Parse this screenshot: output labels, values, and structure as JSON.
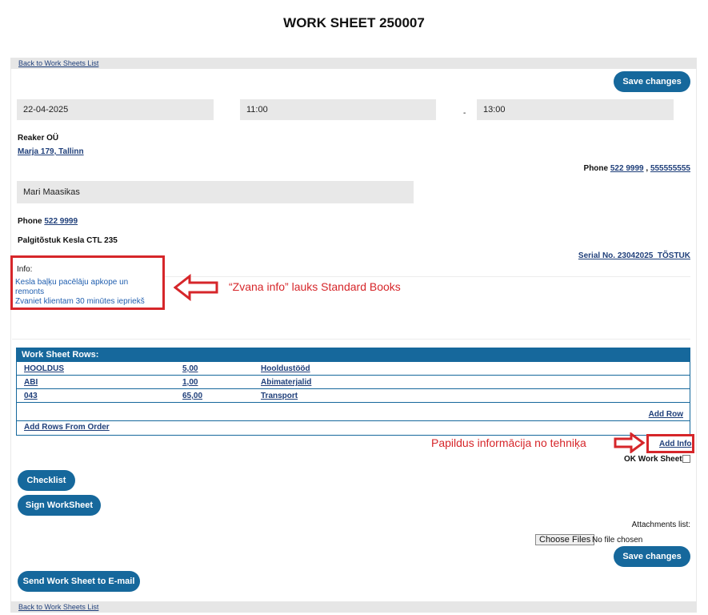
{
  "page": {
    "title": "WORK SHEET 250007"
  },
  "nav": {
    "back_link": "Back to Work Sheets List"
  },
  "actions": {
    "save_label": "Save changes",
    "checklist_label": "Checklist",
    "sign_label": "Sign WorkSheet",
    "send_email_label": "Send Work Sheet to E-mail"
  },
  "schedule": {
    "date": "22-04-2025",
    "time_from": "11:00",
    "separator": "-",
    "time_to": "13:00"
  },
  "client": {
    "name": "Reaker OÜ",
    "address": "Marja 179, Tallinn",
    "phone_label": "Phone",
    "phone1": "522 9999",
    "phone_sep": ",",
    "phone2": "555555555"
  },
  "contact": {
    "name": "Mari Maasikas",
    "phone_label": "Phone",
    "phone": "522 9999"
  },
  "device": {
    "name": "Palgitõstuk Kesla CTL 235",
    "serial": "Serial No. 23042025_TÕSTUK"
  },
  "info": {
    "label": "Info:",
    "line1": "Kesla baļķu pacēlāju apkope un",
    "line2": "remonts",
    "line3": "Zvaniet klientam 30 minūtes iepriekš"
  },
  "annotations": {
    "info_note": "“Zvana info” lauks Standard Books",
    "add_info_note": "Papildus informācija no tehniķa"
  },
  "rows": {
    "header": "Work Sheet Rows:",
    "items": [
      {
        "code": "HOOLDUS",
        "qty": "5,00",
        "name": "Hooldustööd"
      },
      {
        "code": "ABI",
        "qty": "1,00",
        "name": "Abimaterjalid"
      },
      {
        "code": "043",
        "qty": "65,00",
        "name": "Transport"
      }
    ],
    "add_row": "Add Row",
    "add_from_order": "Add Rows From Order"
  },
  "extra": {
    "add_info": "Add Info",
    "ok_label": "OK Work Sheet"
  },
  "attachments": {
    "label": "Attachments list:",
    "choose_files": "Choose Files",
    "no_file": "No file chosen"
  },
  "colors": {
    "accent": "#16689c",
    "annotation": "#d6262a"
  }
}
